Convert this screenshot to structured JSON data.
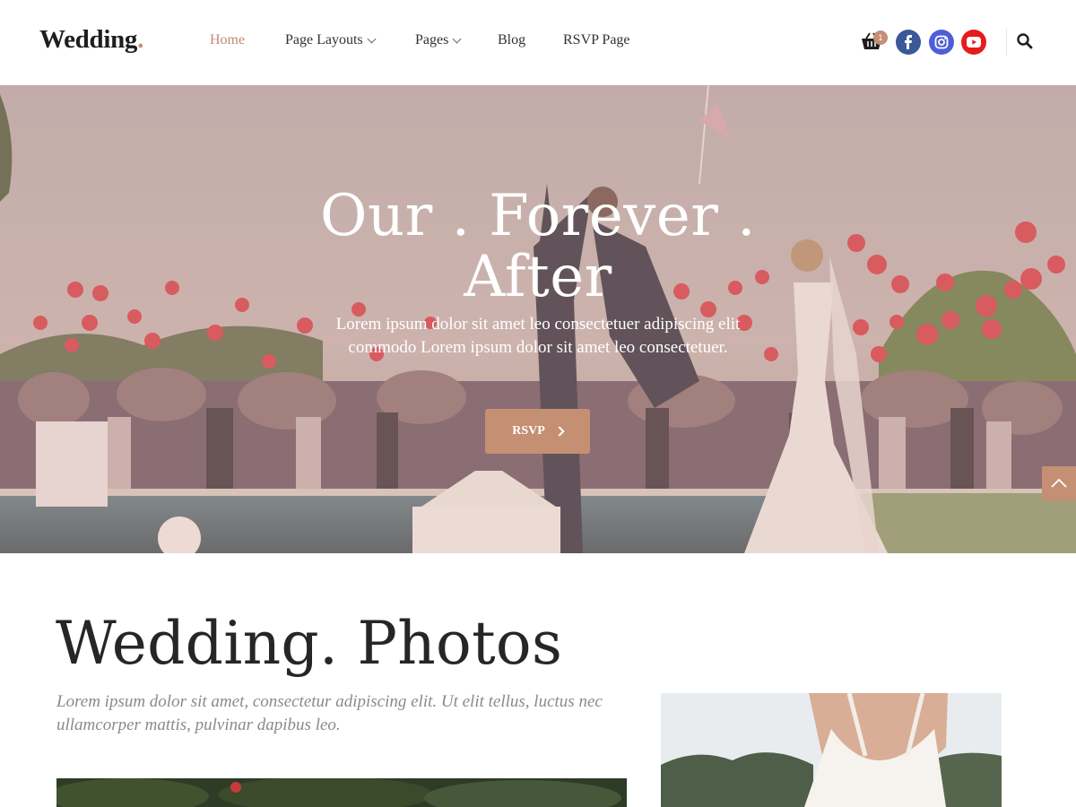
{
  "brand": {
    "name": "Wedding",
    "dot": "."
  },
  "nav": {
    "items": [
      {
        "label": "Home"
      },
      {
        "label": "Page Layouts"
      },
      {
        "label": "Pages"
      },
      {
        "label": "Blog"
      },
      {
        "label": "RSVP Page"
      }
    ]
  },
  "cart": {
    "count": "1"
  },
  "social": [
    "facebook-icon",
    "instagram-icon",
    "youtube-icon"
  ],
  "hero": {
    "title": "Our . Forever . After",
    "text": "Lorem ipsum dolor sit amet leo consectetuer adipiscing elit commodo Lorem ipsum dolor sit amet leo consectetuer.",
    "button": "RSVP"
  },
  "photos": {
    "title": "Wedding. Photos",
    "text": "Lorem ipsum dolor sit amet, consectetur adipiscing elit. Ut elit tellus, luctus nec ullamcorper mattis, pulvinar dapibus leo."
  },
  "colors": {
    "accent": "#c58f73",
    "facebook": "#3b5998",
    "instagram": "#4e5fd7",
    "youtube": "#e51c1c"
  }
}
